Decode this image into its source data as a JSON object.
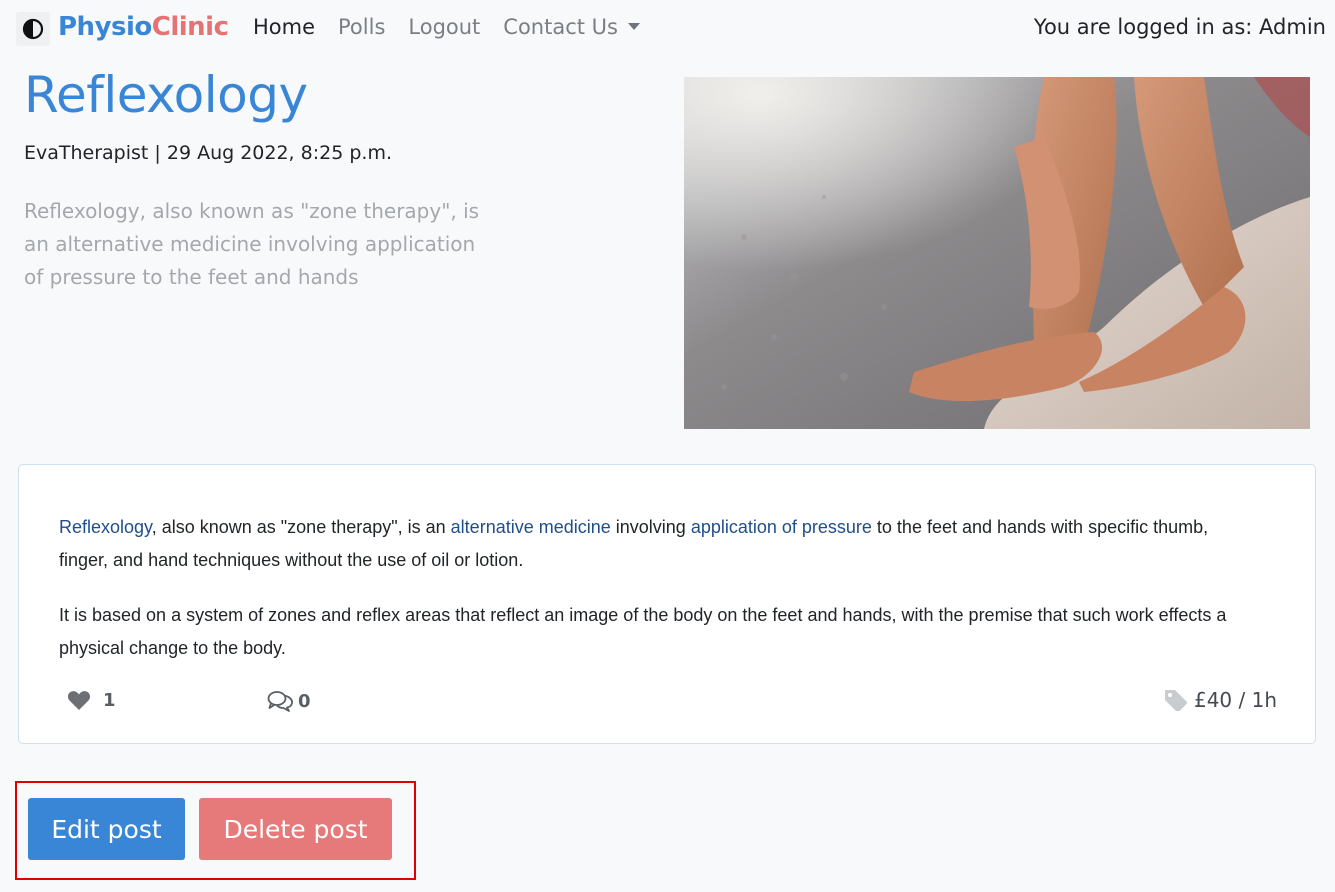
{
  "nav": {
    "brand_part1": "Physio",
    "brand_part2": "Clinic",
    "links": [
      "Home",
      "Polls",
      "Logout",
      "Contact Us"
    ],
    "logged_in_text": "You are logged in as: Admin"
  },
  "post": {
    "title": "Reflexology",
    "meta": "EvaTherapist | 29 Aug 2022, 8:25 p.m.",
    "excerpt": "Reflexology, also known as \"zone therapy\", is an alternative medicine involving application of pressure to the feet and hands",
    "image_description": "feet on a rock on a pebble beach",
    "body": {
      "p1_link1": "Reflexology",
      "p1_text1": ", also known as \"zone therapy\", is an ",
      "p1_link2": "alternative medicine",
      "p1_text2": " involving ",
      "p1_link3": "application of pressure",
      "p1_text3": " to the feet and hands with specific thumb, finger, and hand techniques without the use of oil or lotion.",
      "p2": "It is based on a system of zones and reflex areas that reflect an image of the body on the feet and hands, with the premise that such work effects a physical change to the body."
    },
    "likes": "1",
    "comments": "0",
    "price": "£40 / 1h"
  },
  "actions": {
    "edit_label": "Edit post",
    "delete_label": "Delete post"
  },
  "colors": {
    "primary": "#3a86d6",
    "danger": "#e67a7a",
    "highlight": "#e00000"
  }
}
